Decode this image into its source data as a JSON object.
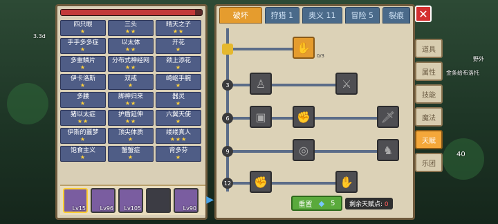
{
  "hp_fill_fraction": 0.95,
  "talents": [
    {
      "name": "四只眼",
      "stars": 1
    },
    {
      "name": "三头",
      "stars": 2
    },
    {
      "name": "晴天之子",
      "stars": 2
    },
    {
      "name": "手手多多症",
      "stars": 1
    },
    {
      "name": "以太体",
      "stars": 2
    },
    {
      "name": "开花",
      "stars": 1
    },
    {
      "name": "多重鳞片",
      "stars": 1
    },
    {
      "name": "分布式神经网",
      "stars": 2
    },
    {
      "name": "颈上添花",
      "stars": 1
    },
    {
      "name": "伊卡洛斯",
      "stars": 1
    },
    {
      "name": "双戒",
      "stars": 1
    },
    {
      "name": "崎岖手腕",
      "stars": 1
    },
    {
      "name": "多腰",
      "stars": 1
    },
    {
      "name": "脚神归来",
      "stars": 2
    },
    {
      "name": "器灵",
      "stars": 1
    },
    {
      "name": "猪以太症",
      "stars": 2
    },
    {
      "name": "护盾延伸",
      "stars": 2
    },
    {
      "name": "六翼天使",
      "stars": 1
    },
    {
      "name": "伊斯的噩梦",
      "stars": 1
    },
    {
      "name": "顶尖体质",
      "stars": 1
    },
    {
      "name": "缕缕真人",
      "stars": 3
    },
    {
      "name": "饱食主义",
      "stars": 1
    },
    {
      "name": "蟹蟹症",
      "stars": 1
    },
    {
      "name": "背多芬",
      "stars": 1
    }
  ],
  "heroes": [
    {
      "lv": "Lv15",
      "selected": true
    },
    {
      "lv": "Lv96",
      "selected": false
    },
    {
      "lv": "Lv105",
      "selected": false
    },
    {
      "lv": "",
      "empty": true
    },
    {
      "lv": "Lv90",
      "selected": false
    }
  ],
  "tabs": [
    "破坏",
    "狩猎 1",
    "奥义 11",
    "冒险 5",
    "裂痕"
  ],
  "top_node_count": "0/3",
  "levels": [
    "3",
    "6",
    "9",
    "12"
  ],
  "reset_label": "重置",
  "reset_cost": "5",
  "remain_label": "剩余天赋点:",
  "remain_value": "0",
  "side_tabs": [
    "道具",
    "属性",
    "技能",
    "魔法",
    "天赋",
    "乐团"
  ],
  "close_symbol": "✕",
  "hud": {
    "level_small": "3.3d",
    "map_name": "野外",
    "chat_text": "金条给布洛托",
    "side_num": "40"
  }
}
